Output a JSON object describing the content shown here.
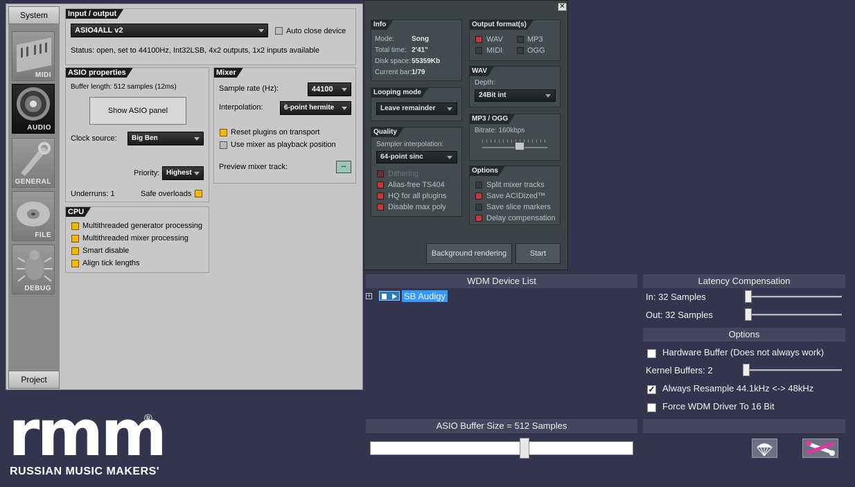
{
  "sidebar": {
    "top_tab": "System",
    "bottom_tab": "Project",
    "items": [
      {
        "label": "MIDI",
        "icon": "keyboard-icon"
      },
      {
        "label": "AUDIO",
        "icon": "speaker-icon"
      },
      {
        "label": "GENERAL",
        "icon": "wrench-icon"
      },
      {
        "label": "FILE",
        "icon": "disc-icon"
      },
      {
        "label": "DEBUG",
        "icon": "bug-icon"
      }
    ]
  },
  "io": {
    "title": "Input / output",
    "device": "ASIO4ALL v2",
    "auto_close_label": "Auto close device",
    "status": "Status: open, set to 44100Hz, Int32LSB, 4x2 outputs, 1x2 inputs available"
  },
  "asio": {
    "title": "ASIO properties",
    "buffer_length": "Buffer length: 512 samples (12ms)",
    "show_panel_label": "Show ASIO panel",
    "clock_label": "Clock source:",
    "clock_value": "Big Ben",
    "priority_label": "Priority:",
    "priority_value": "Highest",
    "underruns": "Underruns: 1",
    "safe_overloads": "Safe overloads"
  },
  "mixer": {
    "title": "Mixer",
    "sample_rate_label": "Sample rate (Hz):",
    "sample_rate_value": "44100",
    "interp_label": "Interpolation:",
    "interp_value": "6-point hermite",
    "reset_plugins": "Reset plugins on transport",
    "use_mixer": "Use mixer as playback position",
    "preview_label": "Preview mixer track:",
    "preview_value": "--"
  },
  "cpu": {
    "title": "CPU",
    "options": [
      "Multithreaded generator processing",
      "Multithreaded mixer processing",
      "Smart disable",
      "Align tick lengths"
    ]
  },
  "render": {
    "close_icon": "close-icon",
    "info": {
      "title": "Info",
      "rows": [
        {
          "label": "Mode:",
          "value": "Song"
        },
        {
          "label": "Total time:",
          "value": "2'41\""
        },
        {
          "label": "Disk space:",
          "value": "55359Kb"
        },
        {
          "label": "Current bar:",
          "value": "1/79"
        }
      ]
    },
    "output_formats": {
      "title": "Output format(s)",
      "items": [
        "WAV",
        "MP3",
        "MIDI",
        "OGG"
      ]
    },
    "wav": {
      "title": "WAV",
      "depth_label": "Depth:",
      "depth_value": "24Bit int"
    },
    "looping": {
      "title": "Looping mode",
      "value": "Leave remainder"
    },
    "mp3ogg": {
      "title": "MP3 / OGG",
      "bitrate": "Bitrate: 160kbps"
    },
    "quality": {
      "title": "Quality",
      "sampler_label": "Sampler interpolation:",
      "sampler_value": "64-point sinc",
      "options": [
        "Dithering",
        "Alias-free TS404",
        "HQ for all plugins",
        "Disable max poly"
      ]
    },
    "options": {
      "title": "Options",
      "items": [
        "Split mixer tracks",
        "Save ACIDized™",
        "Save slice markers",
        "Delay compensation"
      ]
    },
    "bg_render_label": "Background rendering",
    "start_label": "Start"
  },
  "wdm": {
    "device_list_title": "WDM Device List",
    "device_name": "SB Audigy",
    "latency_title": "Latency Compensation",
    "in_label": "In:  32 Samples",
    "out_label": "Out: 32 Samples",
    "options_title": "Options",
    "hardware_buffer": "Hardware Buffer (Does not always work)",
    "kernel_buffers": "Kernel Buffers: 2",
    "always_resample": "Always Resample 44.1kHz <-> 48kHz",
    "force_16bit": "Force WDM Driver To 16 Bit",
    "asio_buffer_title": "ASIO Buffer Size = 512 Samples",
    "asio_buffer_level": 0.59
  },
  "logo": {
    "text": "rmm",
    "tagline": "RUSSIAN MUSIC MAKERS'",
    "reg": "®"
  },
  "colors": {
    "accent_check": "#f2b700",
    "render_check": "#cc3333",
    "selection": "#3399ff"
  }
}
